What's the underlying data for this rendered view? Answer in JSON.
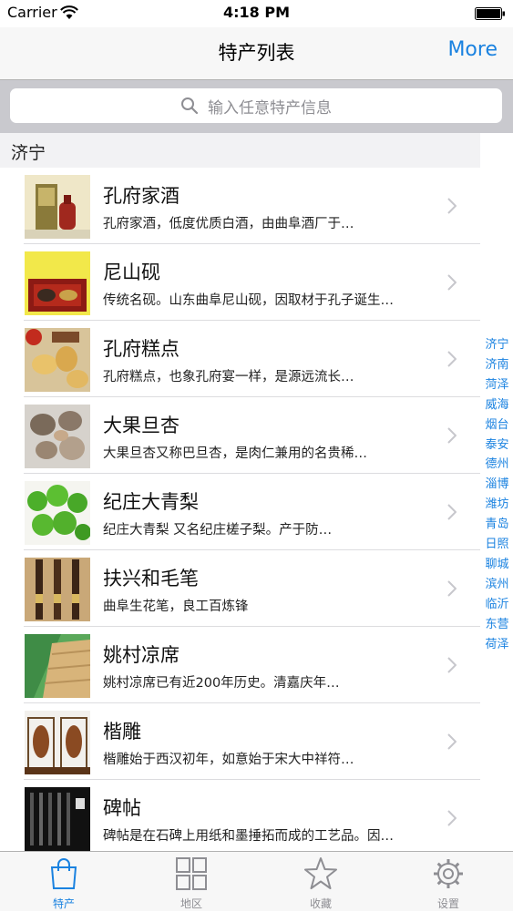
{
  "status_bar": {
    "carrier": "Carrier",
    "time": "4:18 PM"
  },
  "nav": {
    "title": "特产列表",
    "more": "More"
  },
  "search": {
    "placeholder": "输入任意特产信息"
  },
  "section": {
    "title": "济宁"
  },
  "items": [
    {
      "title": "孔府家酒",
      "desc": "孔府家酒，低度优质白酒，由曲阜酒厂于…"
    },
    {
      "title": "尼山砚",
      "desc": "传统名砚。山东曲阜尼山砚，因取材于孔子诞生…"
    },
    {
      "title": "孔府糕点",
      "desc": "孔府糕点，也象孔府宴一样，是源远流长…"
    },
    {
      "title": "大果旦杏",
      "desc": "大果旦杏又称巴旦杏，是肉仁兼用的名贵稀…"
    },
    {
      "title": "纪庄大青梨",
      "desc": "纪庄大青梨 又名纪庄槎子梨。产于防…"
    },
    {
      "title": "扶兴和毛笔",
      "desc": "曲阜生花笔，良工百炼锋"
    },
    {
      "title": "姚村凉席",
      "desc": "姚村凉席已有近200年历史。清嘉庆年…"
    },
    {
      "title": "楷雕",
      "desc": "楷雕始于西汉初年，如意始于宋大中祥符…"
    },
    {
      "title": "碑帖",
      "desc": "碑帖是在石碑上用纸和墨捶拓而成的工艺品。因…"
    }
  ],
  "index": [
    "济宁",
    "济南",
    "菏泽",
    "威海",
    "烟台",
    "泰安",
    "德州",
    "淄博",
    "潍坊",
    "青岛",
    "日照",
    "聊城",
    "滨州",
    "临沂",
    "东营",
    "荷泽"
  ],
  "tabs": [
    {
      "label": "特产",
      "icon": "shopping-bag-icon",
      "active": true
    },
    {
      "label": "地区",
      "icon": "grid-icon",
      "active": false
    },
    {
      "label": "收藏",
      "icon": "star-icon",
      "active": false
    },
    {
      "label": "设置",
      "icon": "gear-icon",
      "active": false
    }
  ],
  "colors": {
    "accent": "#1a82e0",
    "search_bg": "#c9c9ce",
    "section_bg": "#f2f2f4"
  }
}
